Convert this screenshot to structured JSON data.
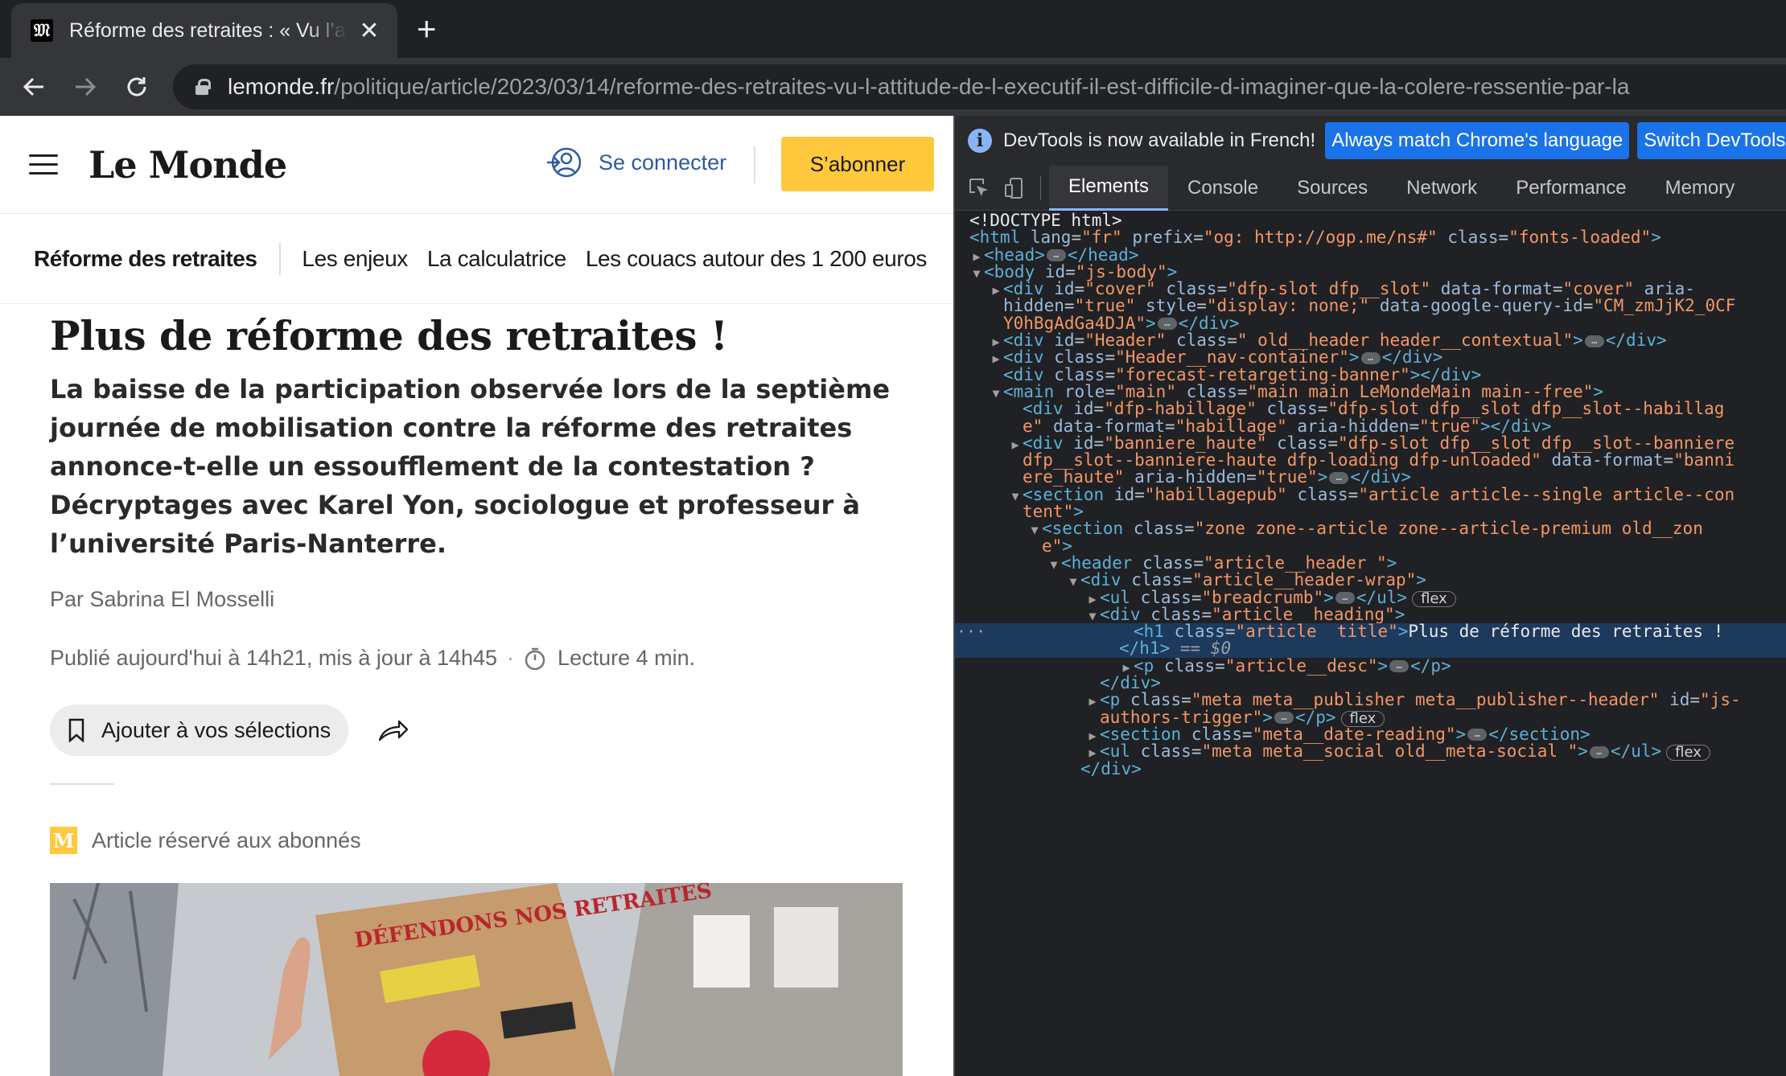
{
  "browser": {
    "tab_title": "Réforme des retraites : « Vu l’attitude de l’exécutif »",
    "tab_favicon": "𝔐",
    "close_glyph": "✕",
    "new_tab_glyph": "+",
    "url_host": "lemonde.fr",
    "url_path": "/politique/article/2023/03/14/reforme-des-retraites-vu-l-attitude-de-l-executif-il-est-difficile-d-imaginer-que-la-colere-ressentie-par-la"
  },
  "site": {
    "logo": "Le Monde",
    "login_label": "Se connecter",
    "subscribe_label": "S’abonner",
    "accent_color": "#ffc83d",
    "subnav": {
      "primary": "Réforme des retraites",
      "items": [
        "Les enjeux",
        "La calculatrice",
        "Les couacs autour des 1 200 euros"
      ]
    }
  },
  "article": {
    "title": "Plus de réforme des retraites !",
    "desc": "La baisse de la participation observée lors de la septième journée de mobilisation contre la réforme des retraites annonce-t-elle un essoufflement de la contestation ? Décryptages avec Karel Yon, sociologue et professeur à l’université Paris-Nanterre.",
    "author": "Par Sabrina El Mosselli",
    "published": "Publié aujourd'hui à 14h21, mis à jour à 14h45",
    "meta_dot": "·",
    "reading": "Lecture 4 min.",
    "bookmark_label": "Ajouter à vos sélections",
    "premium_badge": "M",
    "premium_label": "Article réservé aux abonnés"
  },
  "devtools": {
    "info_text": "DevTools is now available in French!",
    "info_btn_1": "Always match Chrome's language",
    "info_btn_2": "Switch DevTools to French",
    "tabs": [
      "Elements",
      "Console",
      "Sources",
      "Network",
      "Performance",
      "Memory"
    ],
    "selected_suffix": "== $0",
    "flex_badge": "flex"
  }
}
